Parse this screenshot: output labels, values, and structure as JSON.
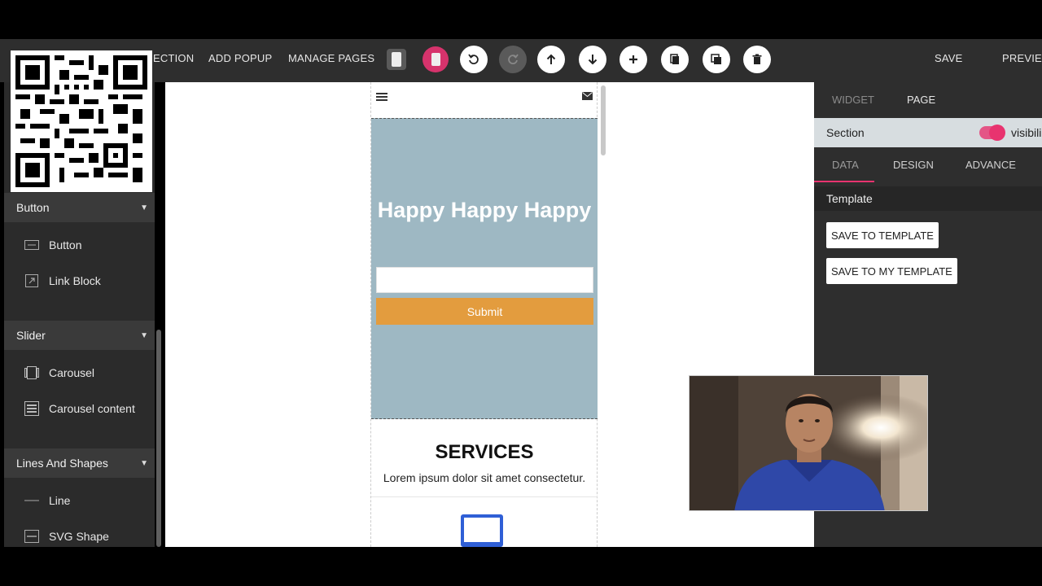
{
  "toolbar": {
    "section_label": "ECTION",
    "add_popup": "ADD POPUP",
    "manage_pages": "MANAGE PAGES",
    "save": "SAVE",
    "preview": "PREVIEW",
    "icons": [
      "tablet-icon",
      "mobile-icon",
      "undo-icon",
      "redo-icon",
      "arrow-up-icon",
      "arrow-down-icon",
      "plus-icon",
      "copy-icon",
      "duplicate-icon",
      "trash-icon"
    ]
  },
  "sidebar": {
    "categories": [
      {
        "label": "Button",
        "items": [
          {
            "label": "Button",
            "icon": "button-icon"
          },
          {
            "label": "Link Block",
            "icon": "link-icon"
          }
        ]
      },
      {
        "label": "Slider",
        "items": [
          {
            "label": "Carousel",
            "icon": "carousel-icon"
          },
          {
            "label": "Carousel content",
            "icon": "carousel-content-icon"
          }
        ]
      },
      {
        "label": "Lines And Shapes",
        "items": [
          {
            "label": "Line",
            "icon": "line-icon"
          },
          {
            "label": "SVG Shape",
            "icon": "svg-shape-icon"
          }
        ]
      }
    ]
  },
  "canvas": {
    "hero": {
      "title": "Happy Happy Happy",
      "input_placeholder": "",
      "submit": "Submit",
      "bg_color": "#9eb8c3",
      "button_color": "#e39c3e"
    },
    "services": {
      "title": "SERVICES",
      "subtitle": "Lorem ipsum dolor sit amet consectetur."
    }
  },
  "right_panel": {
    "tabs": [
      "WIDGET",
      "PAGE"
    ],
    "section_label": "Section",
    "visibility_label": "visibili",
    "sub_tabs": [
      "DATA",
      "DESIGN",
      "ADVANCE"
    ],
    "template_label": "Template",
    "save_to_template": "SAVE TO TEMPLATE",
    "save_to_my_template": "SAVE TO MY TEMPLATE",
    "accent_color": "#e8336f"
  }
}
